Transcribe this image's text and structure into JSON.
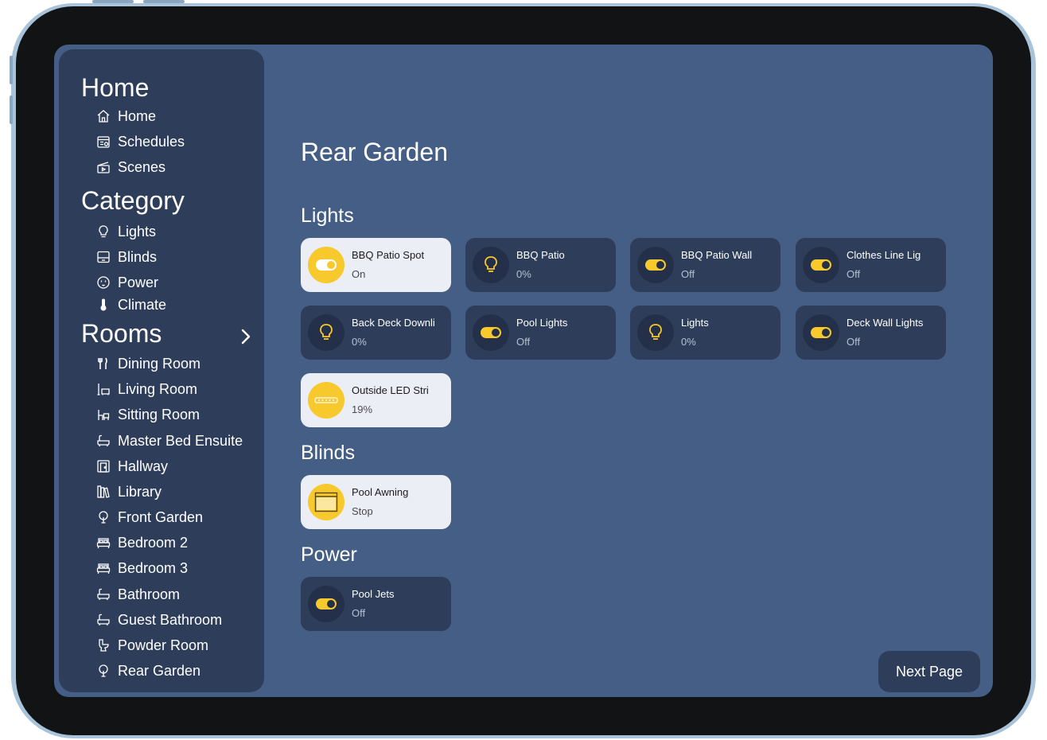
{
  "sidebar": {
    "home_heading": "Home",
    "home_items": [
      {
        "label": "Home",
        "icon": "house-icon"
      },
      {
        "label": "Schedules",
        "icon": "calendar-icon"
      },
      {
        "label": "Scenes",
        "icon": "clapperboard-icon"
      }
    ],
    "category_heading": "Category",
    "category_items": [
      {
        "label": "Lights",
        "icon": "lightbulb-icon"
      },
      {
        "label": "Blinds",
        "icon": "blinds-icon"
      },
      {
        "label": "Power",
        "icon": "power-outlet-icon"
      },
      {
        "label": "Climate",
        "icon": "thermometer-icon"
      }
    ],
    "rooms_heading": "Rooms",
    "rooms_items": [
      {
        "label": "Dining Room",
        "icon": "fork-knife-icon"
      },
      {
        "label": "Living Room",
        "icon": "lamp-sofa-icon"
      },
      {
        "label": "Sitting Room",
        "icon": "armchair-icon"
      },
      {
        "label": "Master Bed Ensuite",
        "icon": "bathtub-icon"
      },
      {
        "label": "Hallway",
        "icon": "door-icon"
      },
      {
        "label": "Library",
        "icon": "books-icon"
      },
      {
        "label": "Front Garden",
        "icon": "tree-icon"
      },
      {
        "label": "Bedroom 2",
        "icon": "bed-icon"
      },
      {
        "label": "Bedroom 3",
        "icon": "bed-icon"
      },
      {
        "label": "Bathroom",
        "icon": "bathtub-icon"
      },
      {
        "label": "Guest Bathroom",
        "icon": "bathtub-icon"
      },
      {
        "label": "Powder Room",
        "icon": "toilet-icon"
      },
      {
        "label": "Rear Garden",
        "icon": "tree-icon"
      }
    ]
  },
  "main": {
    "title": "Rear Garden",
    "sections": {
      "lights": {
        "title": "Lights",
        "tiles": [
          {
            "name": "BBQ Patio Spot",
            "state": "On",
            "icon": "toggle-icon",
            "active": true
          },
          {
            "name": "BBQ Patio",
            "state": "0%",
            "icon": "lightbulb-icon",
            "active": false
          },
          {
            "name": "BBQ Patio Wall",
            "state": "Off",
            "icon": "toggle-icon",
            "active": false
          },
          {
            "name": "Clothes Line Lig",
            "state": "Off",
            "icon": "toggle-icon",
            "active": false
          },
          {
            "name": "Back Deck Downli",
            "state": "0%",
            "icon": "lightbulb-icon",
            "active": false
          },
          {
            "name": "Pool Lights",
            "state": "Off",
            "icon": "toggle-icon",
            "active": false
          },
          {
            "name": "Lights",
            "state": "0%",
            "icon": "lightbulb-icon",
            "active": false
          },
          {
            "name": "Deck Wall Lights",
            "state": "Off",
            "icon": "toggle-icon",
            "active": false
          },
          {
            "name": "Outside LED Stri",
            "state": "19%",
            "icon": "led-strip-icon",
            "active": true
          }
        ]
      },
      "blinds": {
        "title": "Blinds",
        "tiles": [
          {
            "name": "Pool Awning",
            "state": "Stop",
            "icon": "blinds-icon",
            "active": true
          }
        ]
      },
      "power": {
        "title": "Power",
        "tiles": [
          {
            "name": "Pool Jets",
            "state": "Off",
            "icon": "toggle-icon",
            "active": false
          }
        ]
      }
    },
    "next_button": "Next Page"
  },
  "colors": {
    "accent": "#f7c92c",
    "background": "#445e85",
    "panel": "#2e3e5a",
    "active_tile": "#eceef5"
  }
}
